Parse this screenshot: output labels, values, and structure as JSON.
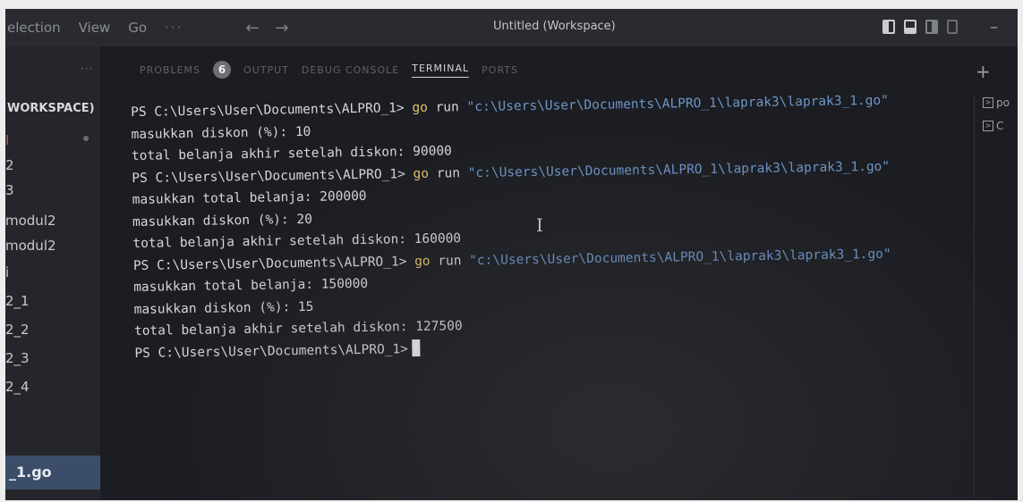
{
  "titlebar": {
    "menu": [
      "election",
      "View",
      "Go",
      "···"
    ],
    "nav_back": "←",
    "nav_forward": "→",
    "window_title": "Untitled (Workspace)",
    "minimize": "–"
  },
  "sidebar": {
    "more": "···",
    "header": "WORKSPACE)",
    "items": [
      {
        "label": "I"
      },
      {
        "label": "2"
      },
      {
        "label": "3"
      },
      {
        "label": "modul2"
      },
      {
        "label": "modul2"
      },
      {
        "label": "i"
      },
      {
        "label": "2_1"
      },
      {
        "label": "2_2"
      },
      {
        "label": "2_3"
      },
      {
        "label": "2_4"
      }
    ],
    "selected": "_1.go"
  },
  "panel": {
    "tabs": [
      "PROBLEMS",
      "OUTPUT",
      "DEBUG CONSOLE",
      "TERMINAL",
      "PORTS"
    ],
    "problems_count": "6",
    "active_tab": "TERMINAL",
    "add": "+",
    "side_items": [
      "po",
      "C"
    ]
  },
  "terminal": {
    "prompt": "PS C:\\Users\\User\\Documents\\ALPRO_1>",
    "cmd": "go",
    "args": "run",
    "path": "\"c:\\Users\\User\\Documents\\ALPRO_1\\laprak3\\laprak3_1.go\"",
    "lines": [
      "masukkan diskon (%): 10",
      "total belanja akhir setelah diskon: 90000",
      "masukkan total belanja: 200000",
      "masukkan diskon (%): 20",
      "total belanja akhir setelah diskon: 160000",
      "masukkan total belanja: 150000",
      "masukkan diskon (%): 15",
      "total belanja akhir setelah diskon: 127500"
    ]
  },
  "colors": {
    "command": "#e4c36a",
    "path": "#6e95c9",
    "selection": "#3c4d6a"
  }
}
